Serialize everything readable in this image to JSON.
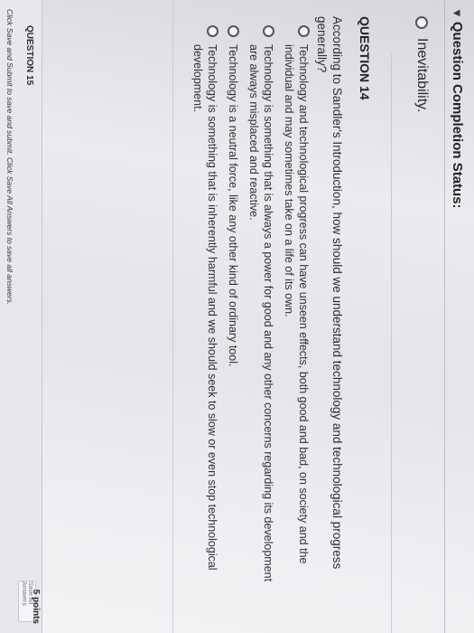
{
  "header": {
    "title": "Question Completion Status:"
  },
  "previous_question": {
    "option_text": "Inevitability."
  },
  "question_14": {
    "title": "QUESTION 14",
    "text": "According to Sandler's Introduction, how should we understand technology and technological progress generally?",
    "options": [
      "Technology and technological progress can have unseen effects, both good and bad, on society and the individual and may sometimes take on a life of its own.",
      "Technology is something that is always a power for good and any other concerns regarding its development are always misplaced and reactive.",
      "Technology is a neutral force, like any other kind of ordinary tool.",
      "Technology is something that is inherently harmful and we should seek to slow or even stop technological development."
    ]
  },
  "question_15": {
    "title": "QUESTION 15",
    "points": "5 points"
  },
  "footer": {
    "instructions": "Click Save and Submit to save and submit. Click Save All Answers to save all answers.",
    "save_all_label": "Save All Answers"
  }
}
